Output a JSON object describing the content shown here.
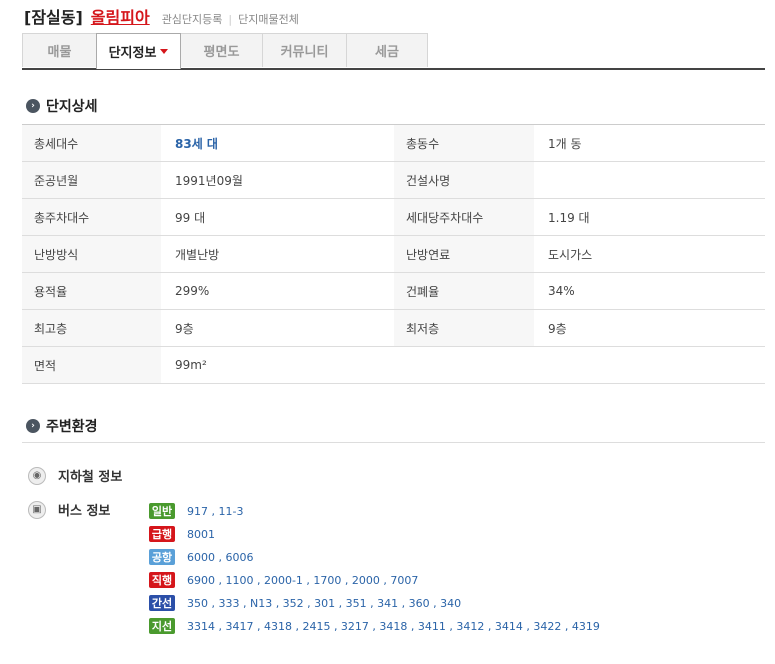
{
  "header": {
    "region": "[잠실동]",
    "apartment": "올림피아",
    "link_watchlist": "관심단지등록",
    "link_listings": "단지매물전체"
  },
  "tabs": [
    {
      "label": "매물"
    },
    {
      "label": "단지정보"
    },
    {
      "label": "평면도"
    },
    {
      "label": "커뮤니티"
    },
    {
      "label": "세금"
    }
  ],
  "detail": {
    "title": "단지상세",
    "rows": [
      {
        "l1": "총세대수",
        "v1": "83세 대",
        "l2": "총동수",
        "v2": "1개 동"
      },
      {
        "l1": "준공년월",
        "v1": "1991년09월",
        "l2": "건설사명",
        "v2": ""
      },
      {
        "l1": "총주차대수",
        "v1": "99 대",
        "l2": "세대당주차대수",
        "v2": "1.19 대"
      },
      {
        "l1": "난방방식",
        "v1": "개별난방",
        "l2": "난방연료",
        "v2": "도시가스"
      },
      {
        "l1": "용적율",
        "v1": "299%",
        "l2": "건폐율",
        "v2": "34%"
      },
      {
        "l1": "최고층",
        "v1": "9층",
        "l2": "최저층",
        "v2": "9층"
      },
      {
        "l1": "면적",
        "v1": "99m²"
      }
    ]
  },
  "environment": {
    "title": "주변환경",
    "subway_label": "지하철 정보",
    "bus_label": "버스 정보",
    "bus_routes": [
      {
        "type": "일반",
        "color": "#4a9a2e",
        "routes": "917 , 11-3"
      },
      {
        "type": "급행",
        "color": "#d5161b",
        "routes": "8001"
      },
      {
        "type": "공항",
        "color": "#5aa0d8",
        "routes": "6000 , 6006"
      },
      {
        "type": "직행",
        "color": "#d5161b",
        "routes": "6900 , 1100 , 2000-1 , 1700 , 2000 , 7007"
      },
      {
        "type": "간선",
        "color": "#2b4fa8",
        "routes": "350 , 333 , N13 , 352 , 301 , 351 , 341 , 360 , 340"
      },
      {
        "type": "지선",
        "color": "#4a9a2e",
        "routes": "3314 , 3417 , 4318 , 2415 , 3217 , 3418 , 3411 , 3412 , 3414 , 3422 , 4319"
      }
    ]
  }
}
